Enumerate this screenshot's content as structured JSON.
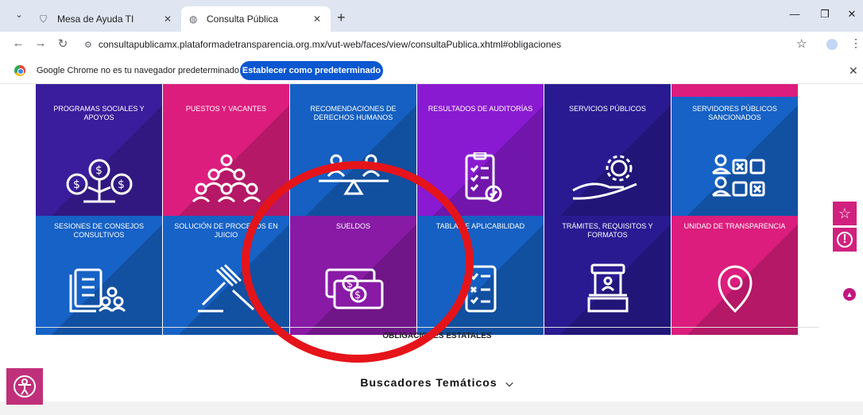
{
  "browser": {
    "tabs": [
      {
        "label": "Mesa de Ayuda TI",
        "active": false
      },
      {
        "label": "Consulta Pública",
        "active": true
      }
    ],
    "url": "consultapublicamx.plataformadetransparencia.org.mx/vut-web/faces/view/consultaPublica.xhtml#obligaciones",
    "infobar_text": "Google Chrome no es tu navegador predeterminado",
    "infobar_button": "Establecer como predeterminado"
  },
  "tiles": [
    {
      "label": "Programas sociales y apoyos",
      "color": "#3a1d9c",
      "icon": "money-tree-icon"
    },
    {
      "label": "Puestos y vacantes",
      "color": "#dc1d7d",
      "icon": "people-group-icon"
    },
    {
      "label": "Recomendaciones de derechos humanos",
      "color": "#1560c2",
      "icon": "balance-people-icon"
    },
    {
      "label": "Resultados de auditorías",
      "color": "#8a1ad1",
      "icon": "clipboard-check-icon"
    },
    {
      "label": "Servicios públicos",
      "color": "#2a1a92",
      "icon": "hand-gear-icon"
    },
    {
      "label": "Servidores públicos sancionados",
      "color": "#1662c6",
      "icon": "people-boxes-icon"
    },
    {
      "label": "Sesiones de consejos consultivos",
      "color": "#1662c6",
      "icon": "documents-people-icon"
    },
    {
      "label": "Solución de procesos en juicio",
      "color": "#1662c6",
      "icon": "gavel-icon"
    },
    {
      "label": "Sueldos",
      "color": "#881aa6",
      "icon": "money-bills-icon"
    },
    {
      "label": "Tabla de aplicabilidad",
      "color": "#1560c2",
      "icon": "checklist-icon"
    },
    {
      "label": "Trámites, requisitos y formatos",
      "color": "#2a1a92",
      "icon": "kiosk-icon"
    },
    {
      "label": "Unidad de transparencia",
      "color": "#dc1d7d",
      "icon": "location-pin-icon"
    }
  ],
  "section_label": "OBLIGACIONES ESTATALES",
  "buscadores_label": "Buscadores Temáticos"
}
